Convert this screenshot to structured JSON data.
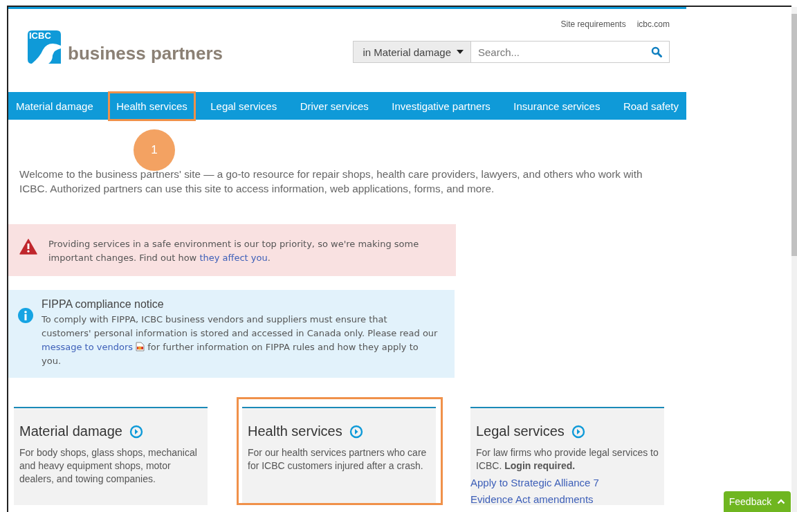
{
  "top_links": [
    "Site requirements",
    "icbc.com"
  ],
  "logo": {
    "badge": "ICBC",
    "name": "business partners"
  },
  "search": {
    "scope": "in Material damage",
    "placeholder": "Search..."
  },
  "nav": [
    {
      "label": "Material damage",
      "highlighted": false
    },
    {
      "label": "Health services",
      "highlighted": true
    },
    {
      "label": "Legal services",
      "highlighted": false
    },
    {
      "label": "Driver services",
      "highlighted": false
    },
    {
      "label": "Investigative partners",
      "highlighted": false
    },
    {
      "label": "Insurance services",
      "highlighted": false
    },
    {
      "label": "Road safety",
      "highlighted": false
    }
  ],
  "callout": {
    "label": "1"
  },
  "intro": "Welcome to the business partners' site — a go-to resource for repair shops, health care providers, lawyers, and others who work with ICBC.  Authorized partners can use this site to access information, web applications, forms, and more.",
  "notices": [
    {
      "kind": "warning",
      "text": "Providing services in a safe environment is our top priority, so we're making some important changes. Find out how ",
      "link": "they affect you",
      "text_after": "."
    },
    {
      "kind": "info",
      "title": "FIPPA compliance notice",
      "text": "To comply with FIPPA, ICBC business vendors and suppliers must ensure that customers' personal information is stored and accessed in Canada only. Please read our ",
      "link": "message to vendors",
      "text_after": " for further information on FIPPA rules and how they apply to you."
    }
  ],
  "cards": [
    {
      "title": "Material damage",
      "text": "For body shops, glass shops, mechanical and heavy equipment shops, motor dealers, and towing companies.",
      "highlighted": false
    },
    {
      "title": "Health services",
      "text": "For our health services partners who care for ICBC customers injured after a crash.",
      "highlighted": true
    },
    {
      "title": "Legal services",
      "text": "For law firms who provide legal services to ICBC. **Login required.**",
      "links": [
        "Apply to Strategic Alliance 7",
        "Evidence Act amendments"
      ],
      "highlighted": false
    }
  ],
  "feedback": {
    "label": "Feedback"
  }
}
